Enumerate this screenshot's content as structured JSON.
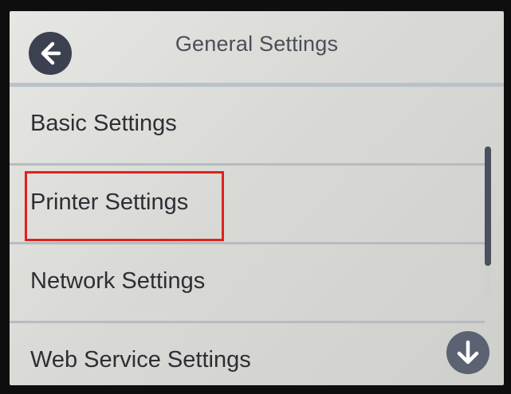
{
  "header": {
    "title": "General Settings",
    "back_icon": "arrow-left-icon"
  },
  "menu": {
    "items": [
      {
        "label": "Basic Settings"
      },
      {
        "label": "Printer Settings",
        "highlighted": true
      },
      {
        "label": "Network Settings"
      },
      {
        "label": "Web Service Settings"
      }
    ]
  },
  "scroll": {
    "down_icon": "arrow-down-icon"
  },
  "colors": {
    "highlight": "#e0211d",
    "button": "#3b4150"
  }
}
